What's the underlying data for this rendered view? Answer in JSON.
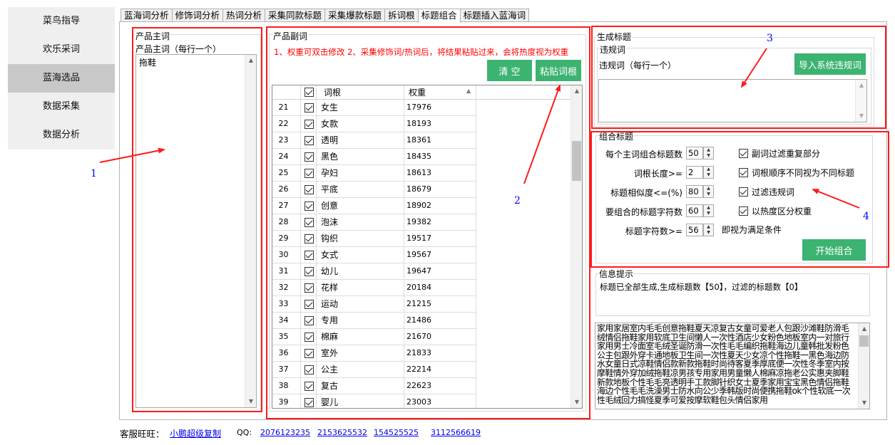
{
  "nav": {
    "items": [
      {
        "label": "菜鸟指导"
      },
      {
        "label": "欢乐采词"
      },
      {
        "label": "蓝海选品"
      },
      {
        "label": "数据采集"
      },
      {
        "label": "数据分析"
      }
    ],
    "active_index": 2
  },
  "tabs": [
    {
      "label": "蓝海词分析"
    },
    {
      "label": "修饰词分析"
    },
    {
      "label": "热词分析"
    },
    {
      "label": "采集同款标题"
    },
    {
      "label": "采集爆款标题"
    },
    {
      "label": "拆词根"
    },
    {
      "label": "标题组合"
    },
    {
      "label": "标题插入蓝海词"
    }
  ],
  "active_tab": 6,
  "main_words": {
    "group_title": "产品主词",
    "hint": "产品主词（每行一个）",
    "value": "拖鞋"
  },
  "sub_words": {
    "group_title": "产品副词",
    "notice": "1、权重可双击修改 2、采集修饰词/热词后，将结果粘贴过来，会将热度视为权重",
    "clear_label": "清 空",
    "paste_label": "粘贴词根",
    "col_word": "词根",
    "col_weight": "权重",
    "rows": [
      {
        "no": "21",
        "word": "女生",
        "weight": "17976"
      },
      {
        "no": "22",
        "word": "女款",
        "weight": "18193"
      },
      {
        "no": "23",
        "word": "透明",
        "weight": "18361"
      },
      {
        "no": "24",
        "word": "黑色",
        "weight": "18435"
      },
      {
        "no": "25",
        "word": "孕妇",
        "weight": "18613"
      },
      {
        "no": "26",
        "word": "平底",
        "weight": "18679"
      },
      {
        "no": "27",
        "word": "创意",
        "weight": "18902"
      },
      {
        "no": "28",
        "word": "泡沫",
        "weight": "19382"
      },
      {
        "no": "29",
        "word": "钩织",
        "weight": "19517"
      },
      {
        "no": "30",
        "word": "女式",
        "weight": "19567"
      },
      {
        "no": "31",
        "word": "幼儿",
        "weight": "19647"
      },
      {
        "no": "32",
        "word": "花样",
        "weight": "20184"
      },
      {
        "no": "33",
        "word": "运动",
        "weight": "21215"
      },
      {
        "no": "34",
        "word": "专用",
        "weight": "21486"
      },
      {
        "no": "35",
        "word": "棉麻",
        "weight": "21670"
      },
      {
        "no": "36",
        "word": "室外",
        "weight": "21833"
      },
      {
        "no": "37",
        "word": "公主",
        "weight": "22214"
      },
      {
        "no": "38",
        "word": "复古",
        "weight": "22623"
      },
      {
        "no": "39",
        "word": "婴儿",
        "weight": "23003"
      }
    ]
  },
  "generate": {
    "group_title": "生成标题",
    "banned_group": "违规词",
    "banned_hint": "违规词（每行一个）",
    "import_label": "导入系统违规词"
  },
  "combine": {
    "group_title": "组合标题",
    "fields": [
      {
        "label": "每个主词组合标题数",
        "value": "50"
      },
      {
        "label": "词根长度>=",
        "value": "2"
      },
      {
        "label": "标题相似度<=(%)",
        "value": "80"
      },
      {
        "label": "要组合的标题字符数",
        "value": "60"
      },
      {
        "label": "标题字符数>=",
        "value": "56"
      }
    ],
    "suffix": "即视为满足条件",
    "checks": [
      {
        "label": "副词过滤重复部分"
      },
      {
        "label": "词根顺序不同视为不同标题"
      },
      {
        "label": "过滤违规词"
      },
      {
        "label": "以热度区分权重"
      }
    ],
    "start_label": "开始组合"
  },
  "info": {
    "group_title": "信息提示",
    "message": "标题已全部生成,生成标题数【50】，过滤的标题数【0】"
  },
  "output_text": "家用家居室内毛毛创意拖鞋夏天凉复古女童可爱老人包跟沙滩鞋防滑毛绒情侣拖鞋家用软底卫生间懒人一次性酒店少女粉色地板室内一对旅行家用男士冷面室毛绒圣诞防滑一次性毛毛编织拖鞋海边儿童韩批发粉色公主包跟外穿卡通地板卫生间一次性夏天少女凉个性拖鞋一黑色海边防水女童日式凉鞋情侣款新款拖鞋时尚待客夏季厚底便一次性冬季室内按摩鞋情外穿加绒拖鞋凉男孩专用家用男童懒人棉麻凉拖老公实惠夹脚鞋新款地板个性毛毛亮透明手工款脚针织女士夏季家用宝宝黑色情侣拖鞋海边个性毛毛洗澡男士防水向公少季韩版时尚便携拖鞋ok个性软底一次性毛绒回力搞怪夏季可爱按摩软鞋包头情侣家用",
  "footer": {
    "service_label": "客服旺旺：",
    "service_link": "小鹏超级复制",
    "qq_label": "QQ:",
    "qq_numbers": [
      "2076123235",
      "2153625532",
      "154525525",
      "3112566619"
    ]
  },
  "annotations": [
    "1",
    "2",
    "3",
    "4"
  ],
  "colors": {
    "accent_green": "#3cb371",
    "highlight_red": "#ff1a1a",
    "annotation_blue": "#0000ff",
    "notice_red": "#ff0000"
  }
}
